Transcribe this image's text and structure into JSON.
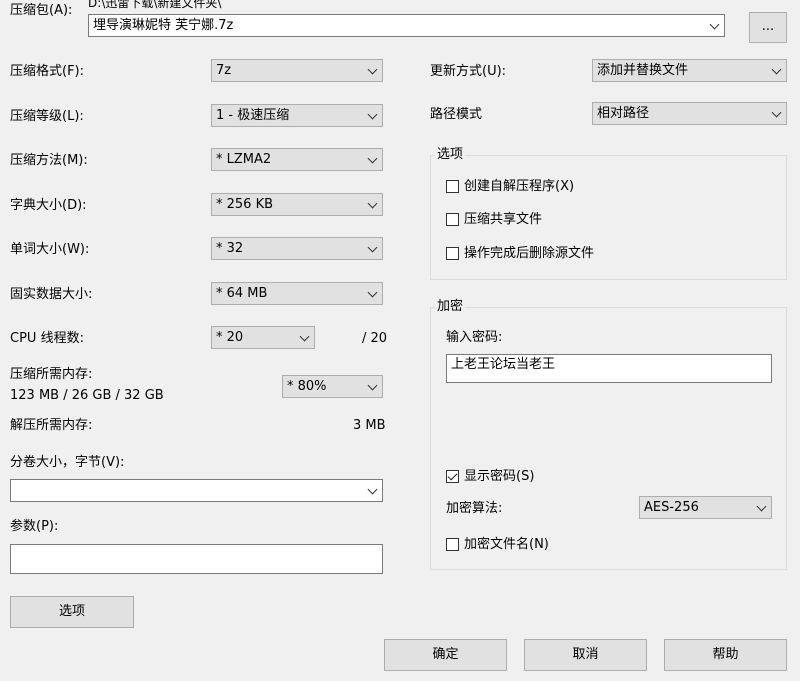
{
  "archive": {
    "label": "压缩包(A):",
    "path": "D:\\迅雷下载\\新建文件夹\\",
    "filename": "埋导演琳妮特 芙宁娜.7z",
    "browse_label": "..."
  },
  "left": {
    "format": {
      "label": "压缩格式(F):",
      "value": "7z"
    },
    "level": {
      "label": "压缩等级(L):",
      "value": "1 - 极速压缩"
    },
    "method": {
      "label": "压缩方法(M):",
      "value": "*  LZMA2"
    },
    "dict": {
      "label": "字典大小(D):",
      "value": "*  256 KB"
    },
    "word": {
      "label": "单词大小(W):",
      "value": "*  32"
    },
    "solid": {
      "label": "固实数据大小:",
      "value": "*  64 MB"
    },
    "threads": {
      "label": "CPU 线程数:",
      "value": "*  20",
      "max": "/ 20"
    },
    "mem_compress": {
      "label": "压缩所需内存:",
      "value": "123 MB / 26 GB / 32 GB",
      "percent": "*  80%"
    },
    "mem_decompress": {
      "label": "解压所需内存:",
      "value": "3 MB"
    },
    "volume": {
      "label": "分卷大小，字节(V):",
      "value": ""
    },
    "params": {
      "label": "参数(P):",
      "value": ""
    },
    "options_button": "选项"
  },
  "right": {
    "update": {
      "label": "更新方式(U):",
      "value": "添加并替换文件"
    },
    "path_mode": {
      "label": "路径模式",
      "value": "相对路径"
    },
    "options_group": {
      "title": "选项",
      "sfx": {
        "label": "创建自解压程序(X)",
        "checked": false
      },
      "shared": {
        "label": "压缩共享文件",
        "checked": false
      },
      "delete": {
        "label": "操作完成后删除源文件",
        "checked": false
      }
    },
    "encryption": {
      "title": "加密",
      "password_label": "输入密码:",
      "password_value": "上老王论坛当老王",
      "show_password": {
        "label": "显示密码(S)",
        "checked": true
      },
      "method_label": "加密算法:",
      "method_value": "AES-256",
      "encrypt_names": {
        "label": "加密文件名(N)",
        "checked": false
      }
    }
  },
  "buttons": {
    "ok": "确定",
    "cancel": "取消",
    "help": "帮助"
  }
}
